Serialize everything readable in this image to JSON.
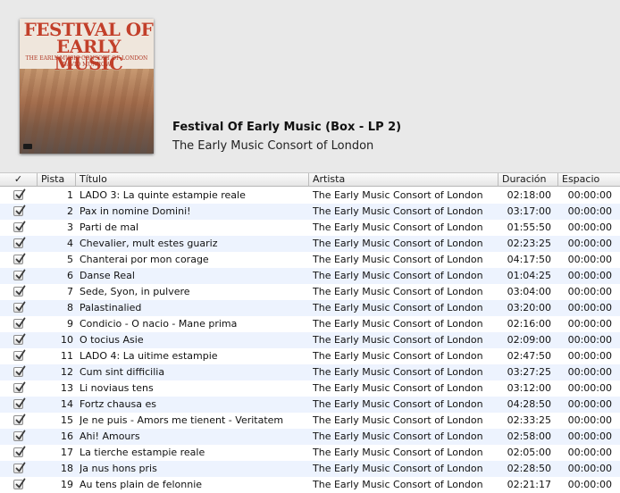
{
  "album": {
    "title": "Festival Of Early Music (Box - LP 2)",
    "artist": "The Early Music Consort of London",
    "art": {
      "title_line1": "FESTIVAL OF",
      "title_line2": "EARLY MUSIC",
      "subtitle_line1": "THE EARLY MUSIC CONSORT OF LONDON",
      "subtitle_line2": "DAVID MUNROW"
    }
  },
  "columns": {
    "check": "✓",
    "track": "Pista",
    "title": "Título",
    "artist": "Artista",
    "duration": "Duración",
    "space": "Espacio"
  },
  "tracks": [
    {
      "checked": true,
      "num": "1",
      "title": "LADO 3: La quinte estampie reale",
      "artist": "The Early Music Consort of London",
      "duration": "02:18:00",
      "space": "00:00:00"
    },
    {
      "checked": true,
      "num": "2",
      "title": "Pax in nomine Domini!",
      "artist": "The Early Music Consort of London",
      "duration": "03:17:00",
      "space": "00:00:00"
    },
    {
      "checked": true,
      "num": "3",
      "title": "Parti de mal",
      "artist": "The Early Music Consort of London",
      "duration": "01:55:50",
      "space": "00:00:00"
    },
    {
      "checked": true,
      "num": "4",
      "title": "Chevalier, mult estes guariz",
      "artist": "The Early Music Consort of London",
      "duration": "02:23:25",
      "space": "00:00:00"
    },
    {
      "checked": true,
      "num": "5",
      "title": "Chanterai por mon corage",
      "artist": "The Early Music Consort of London",
      "duration": "04:17:50",
      "space": "00:00:00"
    },
    {
      "checked": true,
      "num": "6",
      "title": "Danse Real",
      "artist": "The Early Music Consort of London",
      "duration": "01:04:25",
      "space": "00:00:00"
    },
    {
      "checked": true,
      "num": "7",
      "title": "Sede, Syon, in pulvere",
      "artist": "The Early Music Consort of London",
      "duration": "03:04:00",
      "space": "00:00:00"
    },
    {
      "checked": true,
      "num": "8",
      "title": "Palastinalied",
      "artist": "The Early Music Consort of London",
      "duration": "03:20:00",
      "space": "00:00:00"
    },
    {
      "checked": true,
      "num": "9",
      "title": "Condicio - O nacio - Mane prima",
      "artist": "The Early Music Consort of London",
      "duration": "02:16:00",
      "space": "00:00:00"
    },
    {
      "checked": true,
      "num": "10",
      "title": "O tocius Asie",
      "artist": "The Early Music Consort of London",
      "duration": "02:09:00",
      "space": "00:00:00"
    },
    {
      "checked": true,
      "num": "11",
      "title": "LADO 4: La uitime estampie",
      "artist": "The Early Music Consort of London",
      "duration": "02:47:50",
      "space": "00:00:00"
    },
    {
      "checked": true,
      "num": "12",
      "title": "Cum sint difficilia",
      "artist": "The Early Music Consort of London",
      "duration": "03:27:25",
      "space": "00:00:00"
    },
    {
      "checked": true,
      "num": "13",
      "title": "Li noviaus tens",
      "artist": "The Early Music Consort of London",
      "duration": "03:12:00",
      "space": "00:00:00"
    },
    {
      "checked": true,
      "num": "14",
      "title": "Fortz chausa es",
      "artist": "The Early Music Consort of London",
      "duration": "04:28:50",
      "space": "00:00:00"
    },
    {
      "checked": true,
      "num": "15",
      "title": "Je ne puis - Amors me tienent - Veritatem",
      "artist": "The Early Music Consort of London",
      "duration": "02:33:25",
      "space": "00:00:00"
    },
    {
      "checked": true,
      "num": "16",
      "title": "Ahi! Amours",
      "artist": "The Early Music Consort of London",
      "duration": "02:58:00",
      "space": "00:00:00"
    },
    {
      "checked": true,
      "num": "17",
      "title": "La tierche estampie reale",
      "artist": "The Early Music Consort of London",
      "duration": "02:05:00",
      "space": "00:00:00"
    },
    {
      "checked": true,
      "num": "18",
      "title": "Ja nus hons pris",
      "artist": "The Early Music Consort of London",
      "duration": "02:28:50",
      "space": "00:00:00"
    },
    {
      "checked": true,
      "num": "19",
      "title": "Au tens plain de felonnie",
      "artist": "The Early Music Consort of London",
      "duration": "02:21:17",
      "space": "00:00:00"
    }
  ]
}
